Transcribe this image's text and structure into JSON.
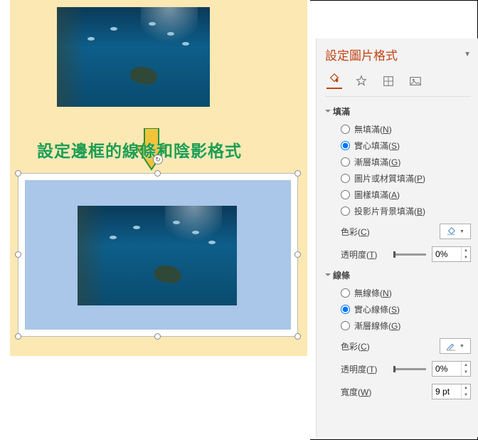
{
  "panel": {
    "title": "設定圖片格式",
    "icons": [
      "fill-icon",
      "effects-icon",
      "size-icon",
      "picture-icon"
    ]
  },
  "canvas": {
    "headline": "設定邊框的線條和陰影格式"
  },
  "fill": {
    "section": "填滿",
    "options": {
      "none": {
        "label": "無填滿",
        "key": "N"
      },
      "solid": {
        "label": "實心填滿",
        "key": "S"
      },
      "gradient": {
        "label": "漸層填滿",
        "key": "G"
      },
      "picture": {
        "label": "圖片或材質填滿",
        "key": "P"
      },
      "pattern": {
        "label": "圖樣填滿",
        "key": "A"
      },
      "slidebg": {
        "label": "投影片背景填滿",
        "key": "B"
      }
    },
    "selected": "solid",
    "color_label": "色彩",
    "color_key": "C",
    "transparency_label": "透明度",
    "transparency_key": "T",
    "transparency_value": "0%"
  },
  "line": {
    "section": "線條",
    "options": {
      "none": {
        "label": "無線條",
        "key": "N"
      },
      "solid": {
        "label": "實心線條",
        "key": "S"
      },
      "gradient": {
        "label": "漸層線條",
        "key": "G"
      }
    },
    "selected": "solid",
    "color_label": "色彩",
    "color_key": "C",
    "transparency_label": "透明度",
    "transparency_key": "T",
    "transparency_value": "0%",
    "width_label": "寬度",
    "width_key": "W",
    "width_value": "9 pt"
  }
}
